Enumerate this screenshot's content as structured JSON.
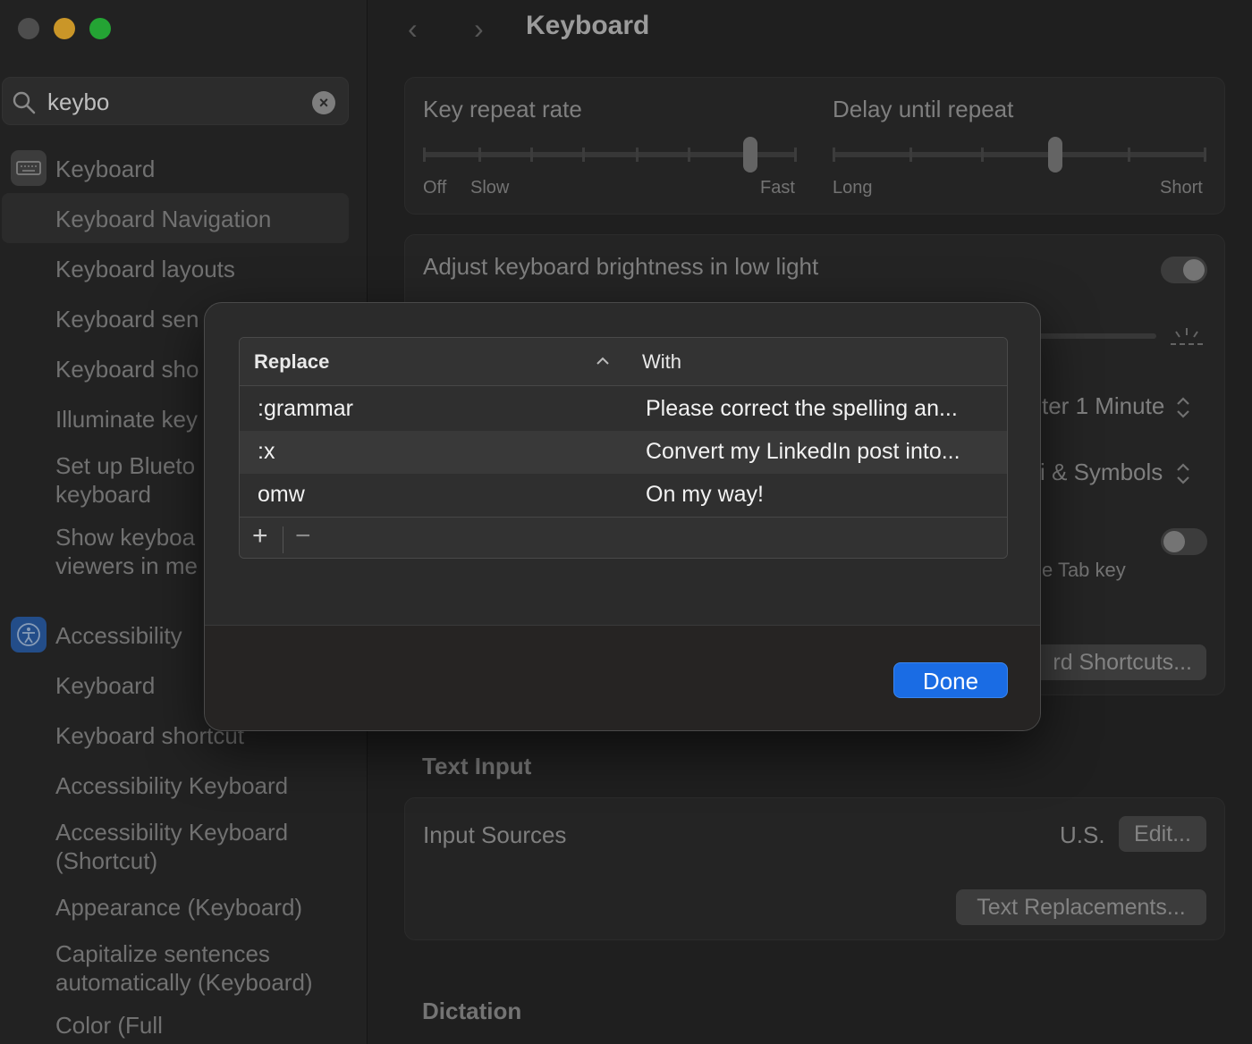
{
  "sidebar": {
    "search": {
      "value": "keybo"
    },
    "items": [
      {
        "label": "Keyboard",
        "icon": "keyboard-icon"
      },
      {
        "label": "Keyboard Navigation",
        "selected": true
      },
      {
        "label": "Keyboard layouts"
      },
      {
        "label": "Keyboard sen"
      },
      {
        "label": "Keyboard sho"
      },
      {
        "label": "Illuminate key"
      },
      {
        "label": "Set up Blueto",
        "label2": "keyboard"
      },
      {
        "label": "Show keyboa",
        "label2": "viewers in me"
      },
      {
        "label": "Accessibility",
        "icon": "accessibility-icon"
      },
      {
        "label": "Keyboard"
      },
      {
        "label": "Keyboard shortcut"
      },
      {
        "label": "Accessibility Keyboard"
      },
      {
        "label": "Accessibility Keyboard",
        "label2": "(Shortcut)"
      },
      {
        "label": "Appearance (Keyboard)"
      },
      {
        "label": "Capitalize sentences",
        "label2": "automatically (Keyboard)"
      },
      {
        "label": "Color (Full"
      }
    ]
  },
  "header": {
    "title": "Keyboard"
  },
  "key_repeat": {
    "label": "Key repeat rate",
    "min_label": "Off",
    "slow_label": "Slow",
    "max_label": "Fast",
    "value_fraction": 0.89
  },
  "delay_repeat": {
    "label": "Delay until repeat",
    "min_label": "Long",
    "max_label": "Short",
    "value_fraction": 0.6
  },
  "brightness": {
    "label": "Adjust keyboard brightness in low light",
    "on": true
  },
  "backlight_off": {
    "value": "ter 1 Minute"
  },
  "globe_key": {
    "value": "i & Symbols"
  },
  "tab_key_text": "e Tab key",
  "shortcuts_button": "rd Shortcuts...",
  "text_input": {
    "section_title": "Text Input",
    "input_sources_label": "Input Sources",
    "input_sources_value": "U.S.",
    "edit_button": "Edit...",
    "text_replacements_button": "Text Replacements..."
  },
  "dictation": {
    "section_title": "Dictation"
  },
  "modal": {
    "columns": {
      "replace": "Replace",
      "with": "With"
    },
    "rows": [
      {
        "replace": ":grammar",
        "with": "Please correct the spelling an..."
      },
      {
        "replace": ":x",
        "with": "Convert my LinkedIn post into..."
      },
      {
        "replace": "omw",
        "with": "On my way!"
      }
    ],
    "add": "+",
    "remove": "−",
    "done_button": "Done"
  },
  "colors": {
    "accent": "#1a6ce4",
    "traffic_min": "#f7b731",
    "traffic_max": "#2cc840"
  }
}
